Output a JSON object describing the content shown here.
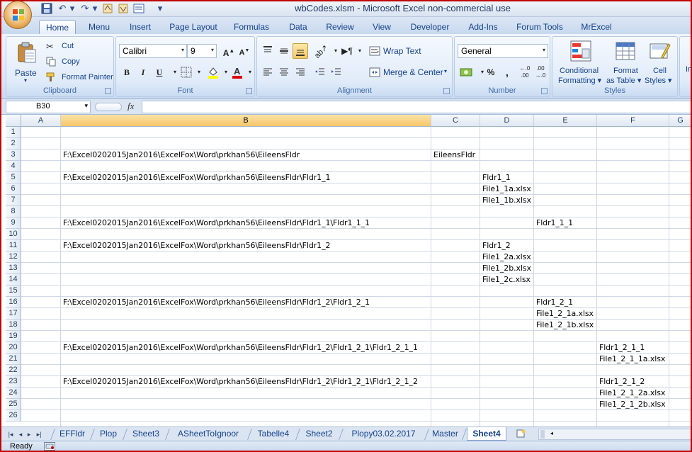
{
  "window": {
    "title": "wbCodes.xlsm - Microsoft Excel non-commercial use"
  },
  "tabs": [
    "Home",
    "Menu",
    "Insert",
    "Page Layout",
    "Formulas",
    "Data",
    "Review",
    "View",
    "Developer",
    "Add-Ins",
    "Forum Tools",
    "MrExcel"
  ],
  "ribbon": {
    "clipboard": {
      "label": "Clipboard",
      "paste": "Paste",
      "cut": "Cut",
      "copy": "Copy",
      "format_painter": "Format Painter"
    },
    "font": {
      "label": "Font",
      "name": "Calibri",
      "size": "9",
      "bold": "B",
      "italic": "I",
      "underline": "U"
    },
    "alignment": {
      "label": "Alignment",
      "wrap_text": "Wrap Text",
      "merge_center": "Merge & Center"
    },
    "number": {
      "label": "Number",
      "format": "General"
    },
    "styles": {
      "label": "Styles",
      "conditional": "Conditional",
      "formatting": "Formatting",
      "format_as": "Format",
      "as_table": "as Table",
      "cell": "Cell",
      "styles": "Styles",
      "insert_partial": "In"
    }
  },
  "formula_bar": {
    "name_box": "B30",
    "fx": "fx",
    "value": ""
  },
  "columns": [
    "A",
    "B",
    "C",
    "D",
    "E",
    "F",
    "G"
  ],
  "rows": [
    "1",
    "2",
    "3",
    "4",
    "5",
    "6",
    "7",
    "8",
    "9",
    "10",
    "11",
    "12",
    "13",
    "14",
    "15",
    "16",
    "17",
    "18",
    "19",
    "20",
    "21",
    "22",
    "23",
    "24",
    "25",
    "26"
  ],
  "cells": {
    "B3": "F:\\Excel0202015Jan2016\\ExcelFox\\Word\\prkhan56\\EileensFldr",
    "C3": "EileensFldr",
    "B5": "F:\\Excel0202015Jan2016\\ExcelFox\\Word\\prkhan56\\EileensFldr\\Fldr1_1",
    "D5": "Fldr1_1",
    "D6": "File1_1a.xlsx",
    "D7": "File1_1b.xlsx",
    "B9": "F:\\Excel0202015Jan2016\\ExcelFox\\Word\\prkhan56\\EileensFldr\\Fldr1_1\\Fldr1_1_1",
    "E9": "Fldr1_1_1",
    "B11": "F:\\Excel0202015Jan2016\\ExcelFox\\Word\\prkhan56\\EileensFldr\\Fldr1_2",
    "D11": "Fldr1_2",
    "D12": "File1_2a.xlsx",
    "D13": "File1_2b.xlsx",
    "D14": "File1_2c.xlsx",
    "B16": "F:\\Excel0202015Jan2016\\ExcelFox\\Word\\prkhan56\\EileensFldr\\Fldr1_2\\Fldr1_2_1",
    "E16": "Fldr1_2_1",
    "E17": "File1_2_1a.xlsx",
    "E18": "File1_2_1b.xlsx",
    "B20": "F:\\Excel0202015Jan2016\\ExcelFox\\Word\\prkhan56\\EileensFldr\\Fldr1_2\\Fldr1_2_1\\Fldr1_2_1_1",
    "F20": "Fldr1_2_1_1",
    "F21": "File1_2_1_1a.xlsx",
    "B23": "F:\\Excel0202015Jan2016\\ExcelFox\\Word\\prkhan56\\EileensFldr\\Fldr1_2\\Fldr1_2_1\\Fldr1_2_1_2",
    "F23": "Fldr1_2_1_2",
    "F24": "File1_2_1_2a.xlsx",
    "F25": "File1_2_1_2b.xlsx"
  },
  "sheet_tabs": [
    "EFFldr",
    "Plop",
    "Sheet3",
    "ASheetToIgnoor",
    "Tabelle4",
    "Sheet2",
    "Plopy03.02.2017",
    "Master",
    "Sheet4"
  ],
  "active_sheet": "Sheet4",
  "status": {
    "text": "Ready"
  },
  "colors": {
    "accent": "#15428b",
    "selected_header": "#f6c66a",
    "frame": "#c00000"
  }
}
